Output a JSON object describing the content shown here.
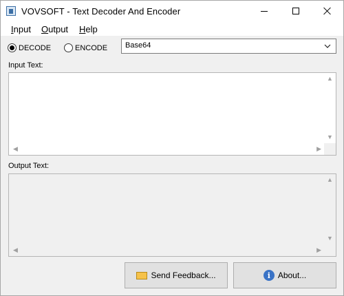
{
  "window": {
    "title": "VOVSOFT - Text Decoder And Encoder"
  },
  "menu": {
    "items": [
      {
        "label": "Input"
      },
      {
        "label": "Output"
      },
      {
        "label": "Help"
      }
    ]
  },
  "mode": {
    "decode": {
      "label": "DECODE",
      "checked": true
    },
    "encode": {
      "label": "ENCODE",
      "checked": false
    }
  },
  "encoding": {
    "selected": "Base64"
  },
  "input": {
    "label": "Input Text:",
    "value": ""
  },
  "output": {
    "label": "Output Text:",
    "value": ""
  },
  "buttons": {
    "feedback": "Send Feedback...",
    "about": "About..."
  },
  "icons": {
    "app": "app-icon",
    "feedback": "envelope-icon",
    "about": "info-icon"
  }
}
